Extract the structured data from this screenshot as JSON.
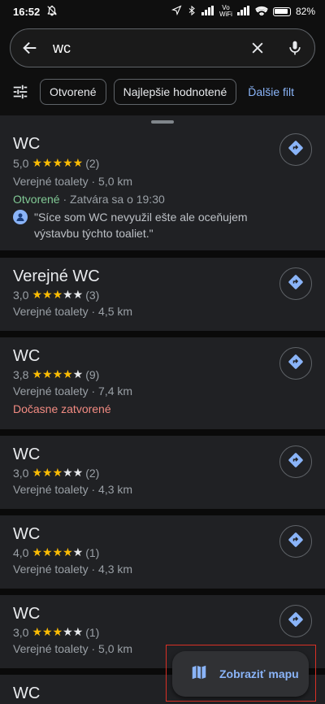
{
  "status_bar": {
    "time": "16:52",
    "battery": "82%",
    "network_label_top": "Vo",
    "network_label_bottom": "WiFi"
  },
  "search": {
    "query": "wc"
  },
  "filters": {
    "chips": [
      "Otvorené",
      "Najlepšie hodnotené"
    ],
    "more": "Ďalšie filt"
  },
  "results": [
    {
      "title": "WC",
      "rating": "5,0",
      "stars": 5,
      "reviews": "(2)",
      "category": "Verejné toalety · 5,0 km",
      "status_open": "Otvorené",
      "status_rest": " · Zatvára sa o 19:30",
      "review": "\"Síce som WC nevyužil ešte ale oceňujem výstavbu týchto toaliet.\""
    },
    {
      "title": "Verejné WC",
      "rating": "3,0",
      "stars": 3,
      "reviews": "(3)",
      "category": "Verejné toalety · 4,5 km"
    },
    {
      "title": "WC",
      "rating": "3,8",
      "stars": 4,
      "reviews": "(9)",
      "category": "Verejné toalety · 7,4 km",
      "status_temp": "Dočasne zatvorené"
    },
    {
      "title": "WC",
      "rating": "3,0",
      "stars": 3,
      "reviews": "(2)",
      "category": "Verejné toalety · 4,3 km"
    },
    {
      "title": "WC",
      "rating": "4,0",
      "stars": 4,
      "reviews": "(1)",
      "category": "Verejné toalety · 4,3 km"
    },
    {
      "title": "WC",
      "rating": "3,0",
      "stars": 3,
      "reviews": "(1)",
      "category": "Verejné toalety · 5,0 km"
    },
    {
      "title": "WC"
    }
  ],
  "map_button": {
    "label": "Zobraziť mapu"
  },
  "colors": {
    "accent": "#8ab4f8",
    "star": "#fbbc04",
    "open": "#81c995",
    "closed": "#f28b82"
  }
}
